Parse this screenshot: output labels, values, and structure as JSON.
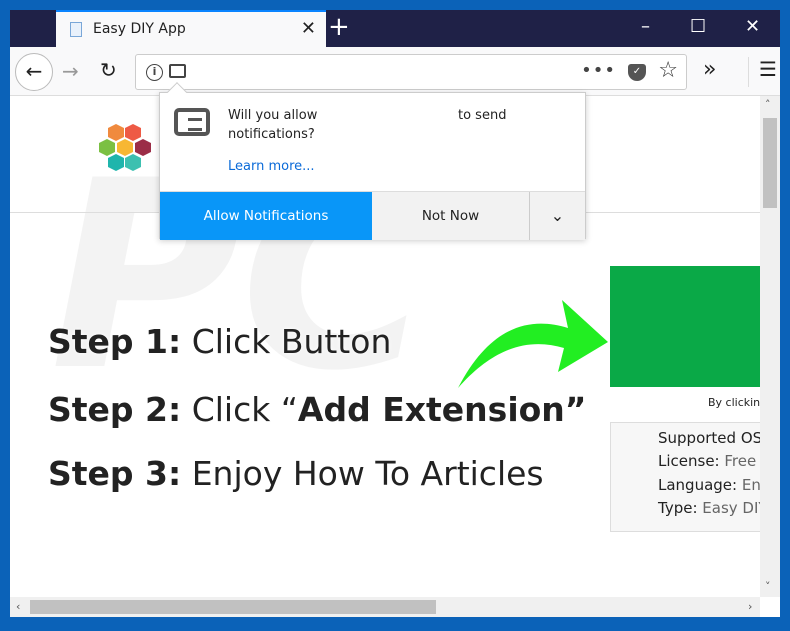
{
  "browser": {
    "tab_title": "Easy DIY App",
    "new_tab": "+",
    "minimize": "–",
    "maximize": "☐",
    "close": "✕",
    "tab_close": "✕"
  },
  "toolbar": {
    "back": "←",
    "forward": "→",
    "reload": "↻",
    "info": "i",
    "more": "•••",
    "overflow": "»",
    "menu": "☰"
  },
  "popup": {
    "message_part1": "Will you allow",
    "message_part2": "to send",
    "message_part3": "notifications?",
    "learn_more": "Learn more...",
    "allow_button": "Allow Notifications",
    "not_now_button": "Not Now",
    "dropdown": "⌄"
  },
  "page": {
    "steps": [
      {
        "label": "Step 1:",
        "text": " Click Button"
      },
      {
        "label": "Step 2:",
        "text": " Click “",
        "bold": "Add Extension”"
      },
      {
        "label": "Step 3:",
        "text": " Enjoy How To Articles"
      }
    ],
    "by_clicking": "By clicking",
    "info": [
      {
        "label": "Supported OS",
        "value": ""
      },
      {
        "label": "License:",
        "value": " Free"
      },
      {
        "label": "Language:",
        "value": " Eng"
      },
      {
        "label": "Type:",
        "value": " Easy DIY"
      }
    ],
    "accent_green": "#0aa947",
    "accent_blue": "#0996f8"
  }
}
